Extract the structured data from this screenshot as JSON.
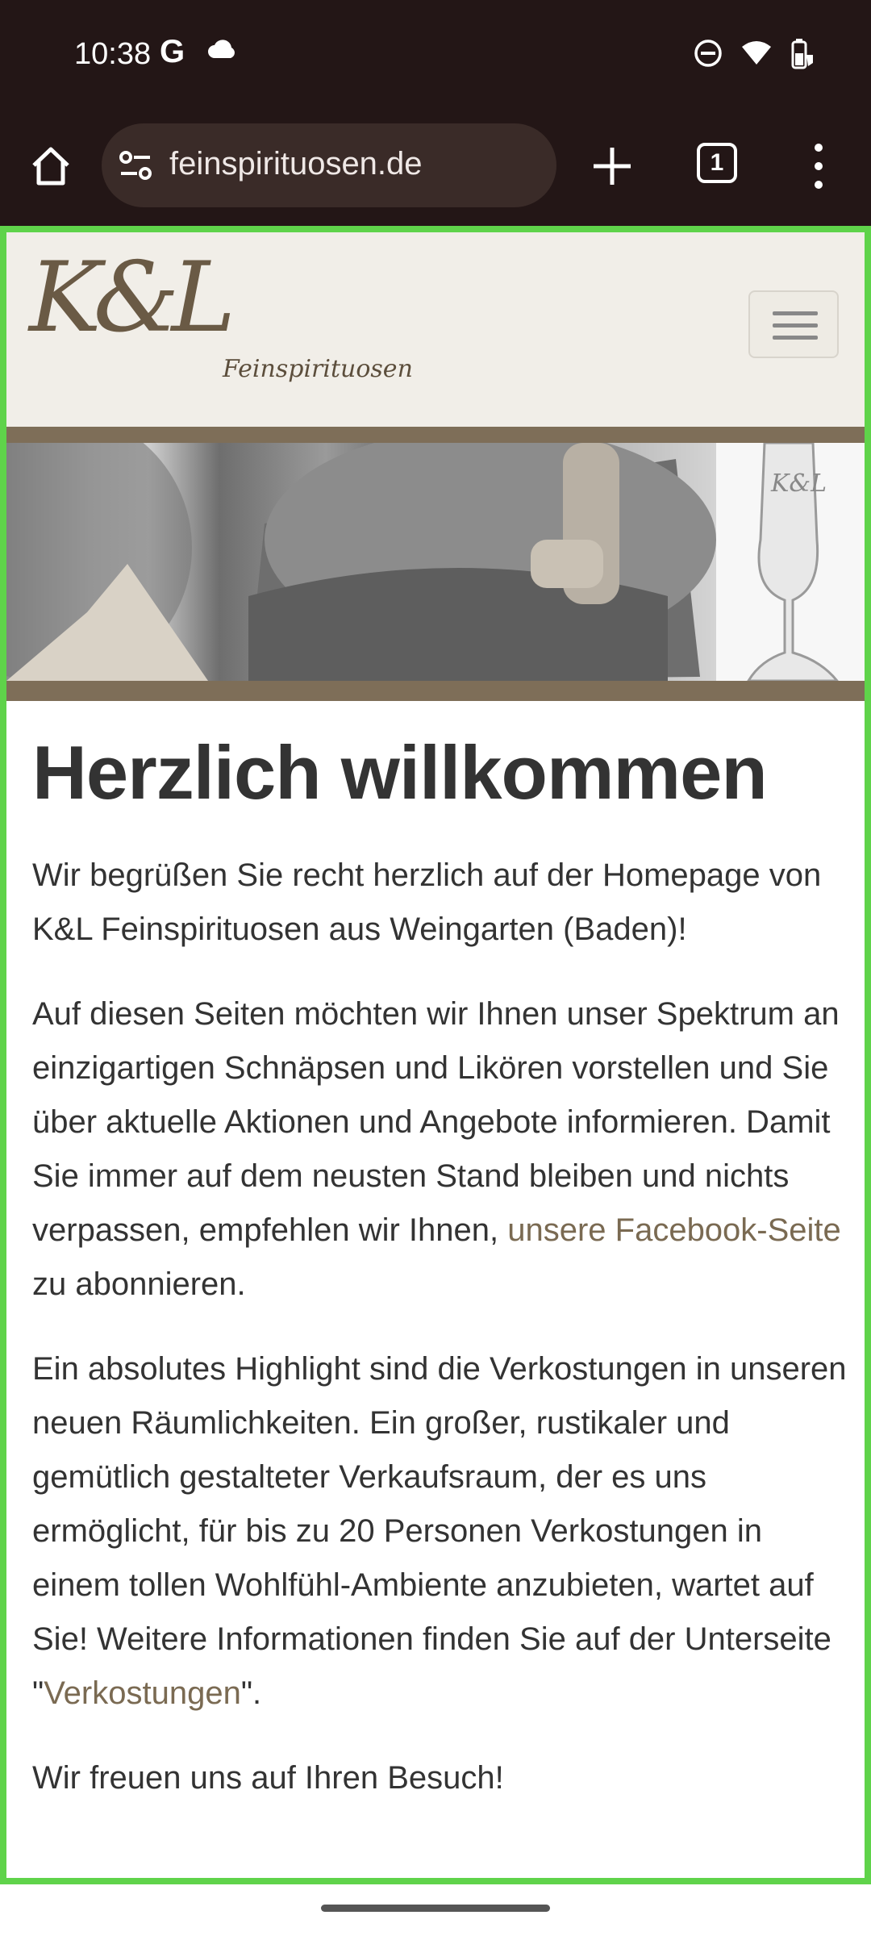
{
  "status_bar": {
    "time": "10:38",
    "left_icons": [
      "google-g-icon",
      "cloud-icon"
    ],
    "right_icons": [
      "do-not-disturb-icon",
      "wifi-icon",
      "battery-icon"
    ]
  },
  "browser": {
    "url": "feinspirituosen.de",
    "tab_count": "1"
  },
  "site": {
    "logo_main": "K&L",
    "logo_sub": "Feinspirituosen",
    "heading": "Herzlich willkommen",
    "p1": "Wir begrüßen Sie recht herzlich auf der Homepage von K&L Feinspirituosen aus Weingarten (Baden)!",
    "p2_before": "Auf diesen Seiten möchten wir Ihnen unser Spektrum an einzigartigen Schnäpsen und Likören vorstellen und Sie über aktuelle Aktionen und Angebote informieren. Damit Sie immer auf dem neusten Stand bleiben und nichts verpassen, empfehlen wir Ihnen, ",
    "p2_link": "unsere Facebook-Seite",
    "p2_after": " zu abonnieren.",
    "p3_before": "Ein absolutes Highlight sind die Verkostungen in unseren neuen Räumlichkeiten. Ein großer, rustikaler und gemütlich gestalteter Verkaufsraum, der es uns ermöglicht, für bis zu 20 Personen Verkostungen in einem tollen Wohlfühl-Ambiente anzubieten, wartet auf Sie! Weitere Informationen finden Sie auf der Unterseite \"",
    "p3_link": "Verkostungen",
    "p3_after": "\".",
    "p4": "Wir freuen uns auf Ihren Besuch!"
  },
  "colors": {
    "brand_brown": "#7e6e58",
    "link": "#7a6a52",
    "header_bg": "#f1eee8",
    "highlight_frame": "#5fd34a"
  }
}
